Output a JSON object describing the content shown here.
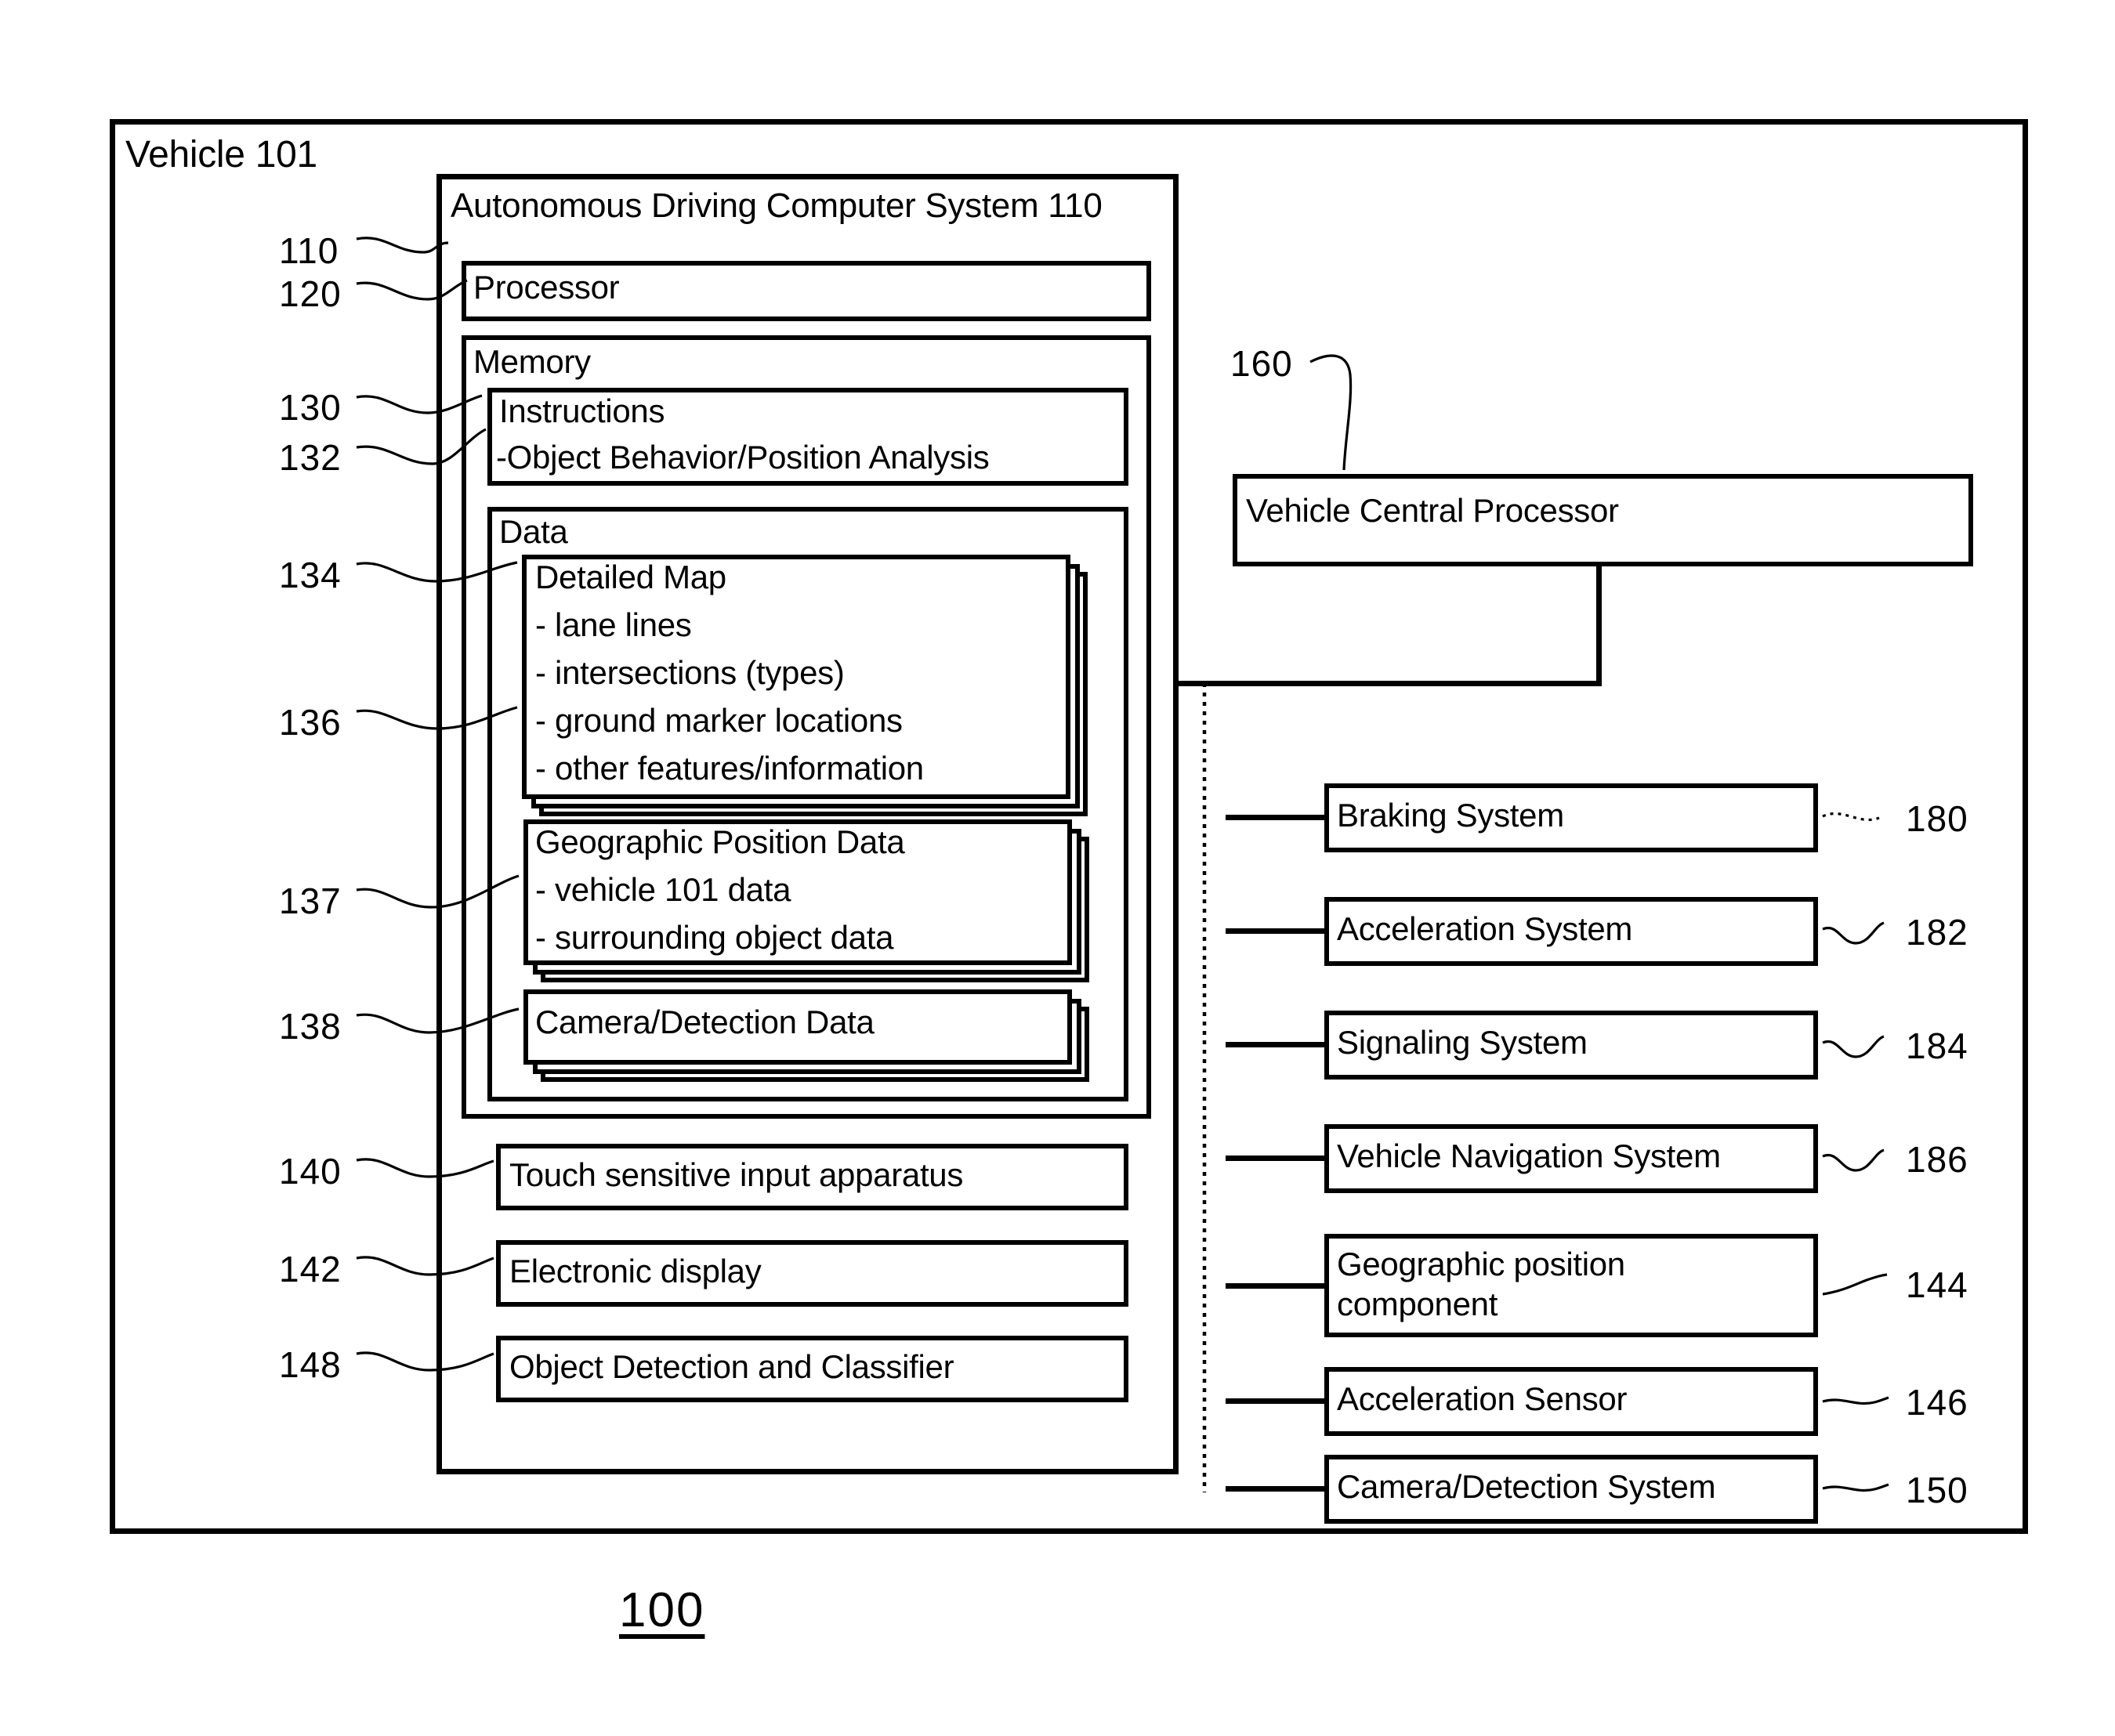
{
  "figure": {
    "number": "100"
  },
  "outer": {
    "label": "Vehicle 101"
  },
  "adcs": {
    "title": "Autonomous Driving Computer System 110",
    "ref_adcs": "110",
    "processor": {
      "label": "Processor",
      "ref": "120"
    },
    "memory": {
      "label": "Memory",
      "instructions": {
        "title": "Instructions",
        "line2": "-Object Behavior/Position Analysis",
        "ref_instructions": "130",
        "ref_analysis": "132"
      },
      "data": {
        "label": "Data",
        "detailed_map": {
          "title": "Detailed Map",
          "items": [
            "- lane lines",
            "- intersections (types)",
            "- ground marker locations",
            "- other features/information"
          ],
          "ref_map": "134",
          "ref_items": "136"
        },
        "geographic_position_data": {
          "title": "Geographic Position Data",
          "items": [
            "- vehicle 101 data",
            "- surrounding object data"
          ],
          "ref": "137"
        },
        "camera_detection_data": {
          "title": "Camera/Detection Data",
          "ref": "138"
        }
      }
    },
    "peripherals": [
      {
        "label": "Touch sensitive input apparatus",
        "ref": "140"
      },
      {
        "label": "Electronic display",
        "ref": "142"
      },
      {
        "label": "Object Detection and Classifier",
        "ref": "148"
      }
    ]
  },
  "vehicle_central_processor": {
    "label": "Vehicle Central Processor",
    "ref": "160"
  },
  "subsystems": [
    {
      "label": "Braking System",
      "ref": "180"
    },
    {
      "label": "Acceleration System",
      "ref": "182"
    },
    {
      "label": "Signaling System",
      "ref": "184"
    },
    {
      "label": "Vehicle Navigation System",
      "ref": "186"
    },
    {
      "label": "Geographic position\ncomponent",
      "ref": "144"
    },
    {
      "label": "Acceleration Sensor",
      "ref": "146"
    },
    {
      "label": "Camera/Detection System",
      "ref": "150"
    }
  ],
  "colors": {
    "ink": "#000000",
    "paper": "#ffffff"
  }
}
